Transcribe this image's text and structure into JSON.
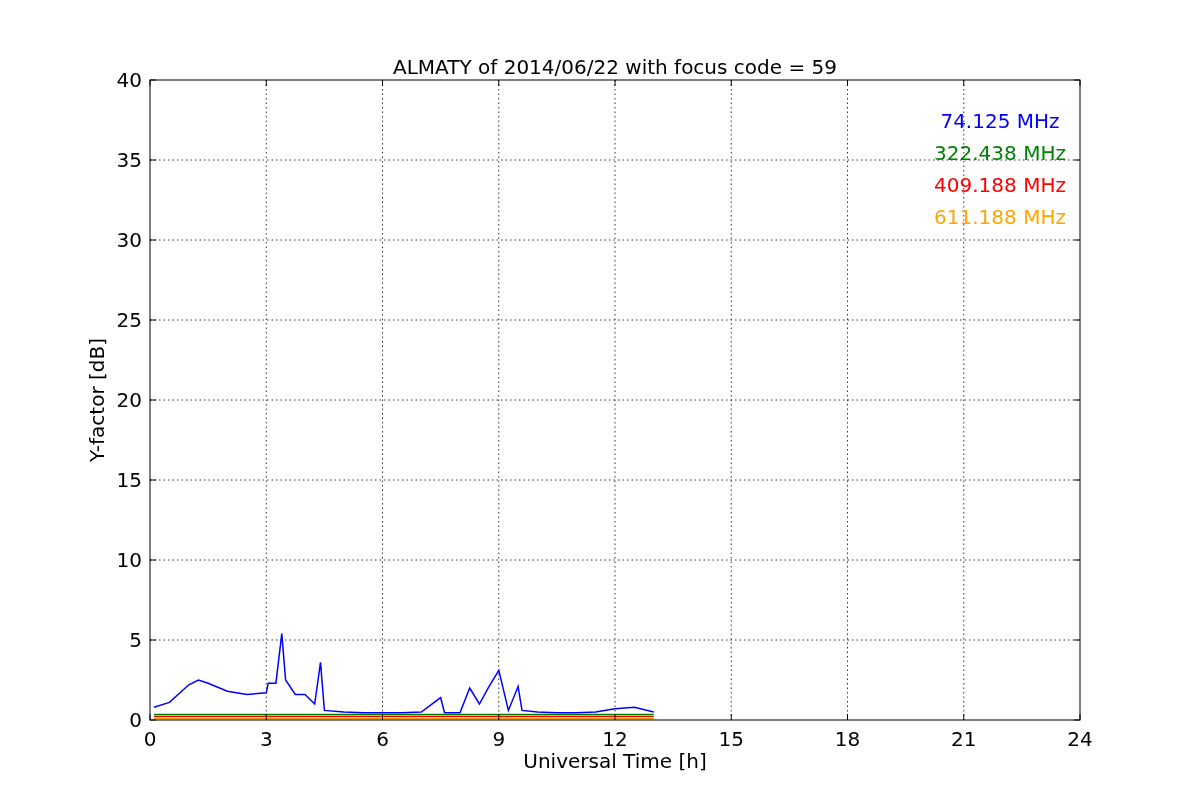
{
  "chart_data": {
    "type": "line",
    "title": "ALMATY of 2014/06/22 with focus code = 59",
    "xlabel": "Universal Time [h]",
    "ylabel": "Y-factor [dB]",
    "xlim": [
      0,
      24
    ],
    "ylim": [
      0,
      40
    ],
    "xticks": [
      0,
      3,
      6,
      9,
      12,
      15,
      18,
      21,
      24
    ],
    "yticks": [
      0,
      5,
      10,
      15,
      20,
      25,
      30,
      35,
      40
    ],
    "grid": true,
    "x": [
      0.1,
      0.5,
      1.0,
      1.25,
      1.5,
      2.0,
      2.5,
      3.0,
      3.05,
      3.25,
      3.4,
      3.5,
      3.75,
      4.0,
      4.25,
      4.4,
      4.5,
      5.0,
      5.5,
      6.0,
      6.5,
      7.0,
      7.5,
      7.6,
      8.0,
      8.25,
      8.5,
      8.75,
      9.0,
      9.25,
      9.5,
      9.6,
      10.0,
      10.5,
      11.0,
      11.5,
      12.0,
      12.5,
      13.0
    ],
    "series": [
      {
        "name": "74.125 MHz",
        "color": "#0000ff",
        "values": [
          0.8,
          1.1,
          2.2,
          2.5,
          2.3,
          1.8,
          1.6,
          1.7,
          2.3,
          2.3,
          5.4,
          2.5,
          1.6,
          1.6,
          1.0,
          3.6,
          0.6,
          0.5,
          0.45,
          0.45,
          0.45,
          0.5,
          1.4,
          0.45,
          0.45,
          2.0,
          1.0,
          2.1,
          3.1,
          0.6,
          2.1,
          0.6,
          0.5,
          0.45,
          0.45,
          0.5,
          0.7,
          0.8,
          0.5
        ]
      },
      {
        "name": "322.438 MHz",
        "color": "#008000",
        "values": [
          0.35,
          0.35,
          0.35,
          0.35,
          0.35,
          0.35,
          0.35,
          0.35,
          0.35,
          0.35,
          0.35,
          0.35,
          0.35,
          0.35,
          0.35,
          0.35,
          0.35,
          0.35,
          0.35,
          0.35,
          0.35,
          0.35,
          0.35,
          0.35,
          0.35,
          0.35,
          0.35,
          0.35,
          0.35,
          0.35,
          0.35,
          0.35,
          0.35,
          0.35,
          0.35,
          0.35,
          0.35,
          0.35,
          0.35
        ]
      },
      {
        "name": "409.188 MHz",
        "color": "#ff0000",
        "values": [
          0.22,
          0.22,
          0.22,
          0.22,
          0.22,
          0.22,
          0.22,
          0.22,
          0.22,
          0.22,
          0.22,
          0.22,
          0.22,
          0.22,
          0.22,
          0.22,
          0.22,
          0.22,
          0.22,
          0.22,
          0.22,
          0.22,
          0.22,
          0.22,
          0.22,
          0.22,
          0.22,
          0.22,
          0.22,
          0.22,
          0.22,
          0.22,
          0.22,
          0.22,
          0.22,
          0.22,
          0.22,
          0.22,
          0.22
        ]
      },
      {
        "name": "611.188 MHz",
        "color": "#ffa500",
        "values": [
          0.08,
          0.08,
          0.08,
          0.08,
          0.08,
          0.08,
          0.08,
          0.08,
          0.08,
          0.08,
          0.08,
          0.08,
          0.08,
          0.08,
          0.08,
          0.08,
          0.08,
          0.08,
          0.08,
          0.08,
          0.08,
          0.08,
          0.08,
          0.08,
          0.08,
          0.08,
          0.08,
          0.08,
          0.08,
          0.08,
          0.08,
          0.08,
          0.08,
          0.08,
          0.08,
          0.08,
          0.08,
          0.08,
          0.08
        ]
      }
    ]
  }
}
